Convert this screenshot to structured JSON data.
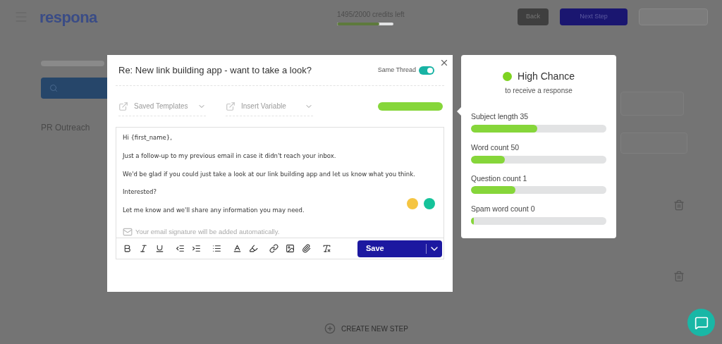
{
  "header": {
    "logo": "respona",
    "credits": "1495/2000 credits left",
    "credits_meter": {
      "level": 0.75
    },
    "back_button": "Back",
    "next_button": "Next Step"
  },
  "page": {
    "section_title": "PR Outreach",
    "create_step": "CREATE NEW STEP"
  },
  "modal": {
    "subject": "Re: New link building app - want to take a look?",
    "same_thread": {
      "label": "Same Thread",
      "on": true
    },
    "templates": {
      "placeholder": "Saved Templates"
    },
    "variables": {
      "placeholder": "Insert Variable"
    },
    "score_meter": {
      "level": 1
    },
    "body": [
      "Hi {first_name},",
      "Just a follow-up to my previous email in case it didn't reach your inbox.",
      "We'd be glad if you could just take a look at our link building app and let us know what you think.",
      "Interested?",
      "Let me know and we'll share any information you may need."
    ],
    "signature_note": "Your email signature will be added automatically.",
    "save_button": "Save"
  },
  "score": {
    "title": "High Chance",
    "subtitle": "to receive a response",
    "color": "#7ed321",
    "metrics": [
      {
        "label": "Subject length 35",
        "level": 0.49
      },
      {
        "label": "Word count 50",
        "level": 0.25
      },
      {
        "label": "Question count 1",
        "level": 0.33
      },
      {
        "label": "Spam word count 0",
        "level": 0.02
      }
    ]
  }
}
